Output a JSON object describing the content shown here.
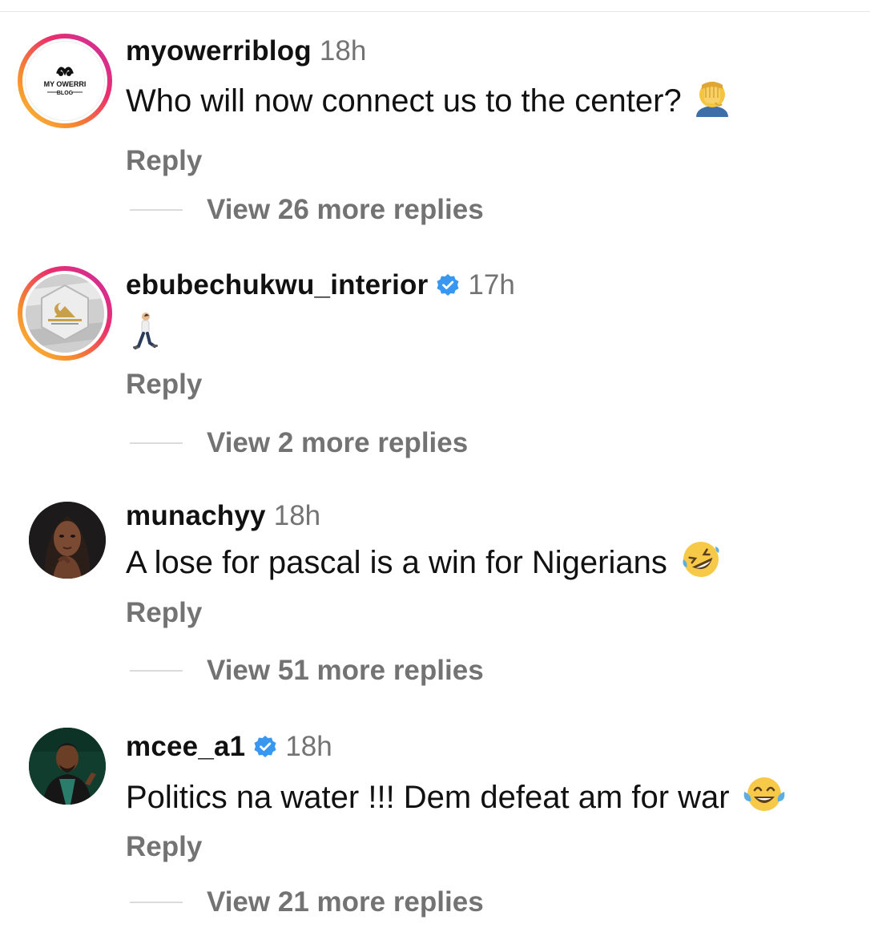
{
  "comments": [
    {
      "username": "myowerriblog",
      "verified": false,
      "time": "18h",
      "text": "Who will now connect us to the center?",
      "emoji": "facepalm",
      "avatar_text": "MY OWERRI",
      "avatar_subtext": "BLOG",
      "reply_label": "Reply",
      "view_replies": "View 26 more replies"
    },
    {
      "username": "ebubechukwu_interior",
      "verified": true,
      "time": "17h",
      "text": "",
      "emoji": "person-walking",
      "reply_label": "Reply",
      "view_replies": "View 2 more replies"
    },
    {
      "username": "munachyy",
      "verified": false,
      "time": "18h",
      "text": "A lose for pascal is a win for Nigerians",
      "emoji": "rolling-on-floor-laughing",
      "reply_label": "Reply",
      "view_replies": "View 51 more replies"
    },
    {
      "username": "mcee_a1",
      "verified": true,
      "time": "18h",
      "text": "Politics na water !!! Dem defeat am for war",
      "emoji": "face-with-tears-of-joy",
      "reply_label": "Reply",
      "view_replies": "View 21 more replies"
    }
  ],
  "colors": {
    "verified_blue": "#3897f0",
    "secondary_text": "#737373",
    "divider": "#dbdbdb"
  }
}
